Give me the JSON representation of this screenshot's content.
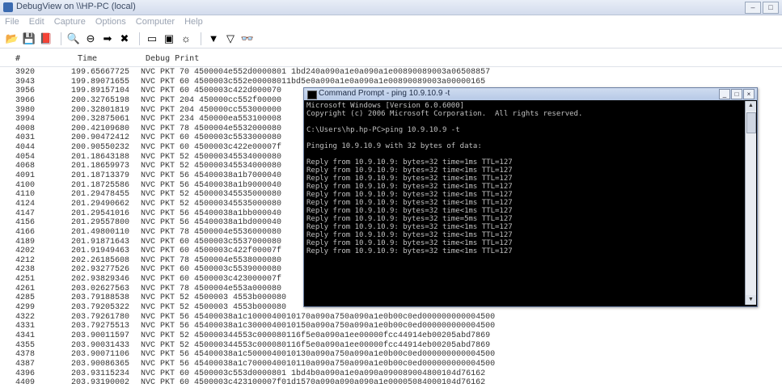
{
  "window": {
    "title": "DebugView on \\\\HP-PC (local)",
    "controls": [
      "–",
      "□"
    ]
  },
  "menu": [
    "File",
    "Edit",
    "Capture",
    "Options",
    "Computer",
    "Help"
  ],
  "toolbar": [
    {
      "name": "open-icon",
      "glyph": "📂"
    },
    {
      "name": "save-icon",
      "glyph": "💾"
    },
    {
      "name": "log-icon",
      "glyph": "📕"
    },
    {
      "name": "find-icon",
      "glyph": "🔍"
    },
    {
      "name": "capture-icon",
      "glyph": "⊖"
    },
    {
      "name": "autoscroll-icon",
      "glyph": "➡"
    },
    {
      "name": "clear-icon",
      "glyph": "✖"
    },
    {
      "name": "capture-kernel-icon",
      "glyph": "▭"
    },
    {
      "name": "capture-win32-icon",
      "glyph": "▣"
    },
    {
      "name": "clock-icon",
      "glyph": "☼"
    },
    {
      "name": "filter-icon",
      "glyph": "▼"
    },
    {
      "name": "highlight-icon",
      "glyph": "▽"
    },
    {
      "name": "binoculars-icon",
      "glyph": "👓"
    }
  ],
  "columns": {
    "num": "#",
    "time": "Time",
    "message": "Debug Print"
  },
  "log": [
    {
      "num": "3920",
      "time": "199.65667725",
      "msg": "NVC PKT 70 4500004e552d0000801 1bd240a090a1e0a090a1e00890089003a06508857"
    },
    {
      "num": "3943",
      "time": "199.89071655",
      "msg": "NVC PKT 60 4500003c552e00008011bd5e0a090a1e0a090a1e00890089003a00000165"
    },
    {
      "num": "3956",
      "time": "199.89157104",
      "msg": "NVC PKT 60 4500003c422d000070"
    },
    {
      "num": "3966",
      "time": "200.32765198",
      "msg": "NVC PKT 204 450000cc552f00000"
    },
    {
      "num": "3980",
      "time": "200.32801819",
      "msg": "NVC PKT 204 450000cc553000000"
    },
    {
      "num": "3994",
      "time": "200.32875061",
      "msg": "NVC PKT 234 450000ea553100008"
    },
    {
      "num": "4008",
      "time": "200.42109680",
      "msg": "NVC PKT 78 4500004e5532000080"
    },
    {
      "num": "4031",
      "time": "200.90472412",
      "msg": "NVC PKT 60 4500003c5533000080"
    },
    {
      "num": "4044",
      "time": "200.90550232",
      "msg": "NVC PKT 60 4500003c422e00007f"
    },
    {
      "num": "4054",
      "time": "201.18643188",
      "msg": "NVC PKT 52 450000345534000080"
    },
    {
      "num": "4068",
      "time": "201.18659973",
      "msg": "NVC PKT 52 450000345534000080"
    },
    {
      "num": "4091",
      "time": "201.18713379",
      "msg": "NVC PKT 56 45400038a1b7000040"
    },
    {
      "num": "4100",
      "time": "201.18725586",
      "msg": "NVC PKT 56 45400038a1b9000040"
    },
    {
      "num": "4110",
      "time": "201.29478455",
      "msg": "NVC PKT 52 450000345535000080"
    },
    {
      "num": "4124",
      "time": "201.29490662",
      "msg": "NVC PKT 52 450000345535000080"
    },
    {
      "num": "4147",
      "time": "201.29541016",
      "msg": "NVC PKT 56 45400038a1bb000040"
    },
    {
      "num": "4156",
      "time": "201.29557800",
      "msg": "NVC PKT 56 45400038a1bd000040"
    },
    {
      "num": "4166",
      "time": "201.49800110",
      "msg": "NVC PKT 78 4500004e5536000080"
    },
    {
      "num": "4189",
      "time": "201.91871643",
      "msg": "NVC PKT 60 4500003c5537000080"
    },
    {
      "num": "4202",
      "time": "201.91949463",
      "msg": "NVC PKT 60 4500003c422f00007f"
    },
    {
      "num": "4212",
      "time": "202.26185608",
      "msg": "NVC PKT 78 4500004e5538000080"
    },
    {
      "num": "4238",
      "time": "202.93277526",
      "msg": "NVC PKT 60 4500003c5539000080"
    },
    {
      "num": "4251",
      "time": "202.93829346",
      "msg": "NVC PKT 60 4500003c423000007f"
    },
    {
      "num": "4261",
      "time": "203.02627563",
      "msg": "NVC PKT 78 4500004e553a000080"
    },
    {
      "num": "4285",
      "time": "203.79188538",
      "msg": "NVC PKT 52 4500003 4553b000080"
    },
    {
      "num": "4299",
      "time": "203.79205322",
      "msg": "NVC PKT 52 4500003 4553b000080"
    },
    {
      "num": "4322",
      "time": "203.79261780",
      "msg": "NVC PKT 56 45400038a1c1000040010170a090a750a090a1e0b00c0ed000000000004500"
    },
    {
      "num": "4331",
      "time": "203.79275513",
      "msg": "NVC PKT 56 45400038a1c3000040010150a090a750a090a1e0b00c0ed000000000004500"
    },
    {
      "num": "4341",
      "time": "203.90011597",
      "msg": "NVC PKT 52 450000344553c000080116f5e0a090a1ee00000fcc44914eb00205abd7869"
    },
    {
      "num": "4355",
      "time": "203.90031433",
      "msg": "NVC PKT 52 450000344553c000080116f5e0a090a1ee00000fcc44914eb00205abd7869"
    },
    {
      "num": "4378",
      "time": "203.90071106",
      "msg": "NVC PKT 56 45400038a1c5000040010130a090a750a090a1e0b00c0ed000000000004500"
    },
    {
      "num": "4387",
      "time": "203.90086365",
      "msg": "NVC PKT 56 45400038a1c7000040010110a090a750a090a1e0b00c0ed000000000004500"
    },
    {
      "num": "4396",
      "time": "203.93115234",
      "msg": "NVC PKT 60 4500003c553d0000801 1bd4b0a090a1e0a090a090089004800104d76162"
    },
    {
      "num": "4409",
      "time": "203.93190002",
      "msg": "NVC PKT 60 4500003c423100007f01d1570a090a090a090a1e00005084000104d76162"
    }
  ],
  "cmd": {
    "title": "Command Prompt - ping 10.9.10.9 -t",
    "controls": [
      "_",
      "□",
      "×"
    ],
    "lines": [
      "Microsoft Windows [Version 6.0.6000]",
      "Copyright (c) 2006 Microsoft Corporation.  All rights reserved.",
      "",
      "C:\\Users\\hp.hp-PC>ping 10.9.10.9 -t",
      "",
      "Pinging 10.9.10.9 with 32 bytes of data:",
      "",
      "Reply from 10.9.10.9: bytes=32 time=1ms TTL=127",
      "Reply from 10.9.10.9: bytes=32 time<1ms TTL=127",
      "Reply from 10.9.10.9: bytes=32 time<1ms TTL=127",
      "Reply from 10.9.10.9: bytes=32 time<1ms TTL=127",
      "Reply from 10.9.10.9: bytes=32 time<1ms TTL=127",
      "Reply from 10.9.10.9: bytes=32 time<1ms TTL=127",
      "Reply from 10.9.10.9: bytes=32 time<1ms TTL=127",
      "Reply from 10.9.10.9: bytes=32 time=5ms TTL=127",
      "Reply from 10.9.10.9: bytes=32 time<1ms TTL=127",
      "Reply from 10.9.10.9: bytes=32 time<1ms TTL=127",
      "Reply from 10.9.10.9: bytes=32 time<1ms TTL=127",
      "Reply from 10.9.10.9: bytes=32 time<1ms TTL=127"
    ]
  }
}
